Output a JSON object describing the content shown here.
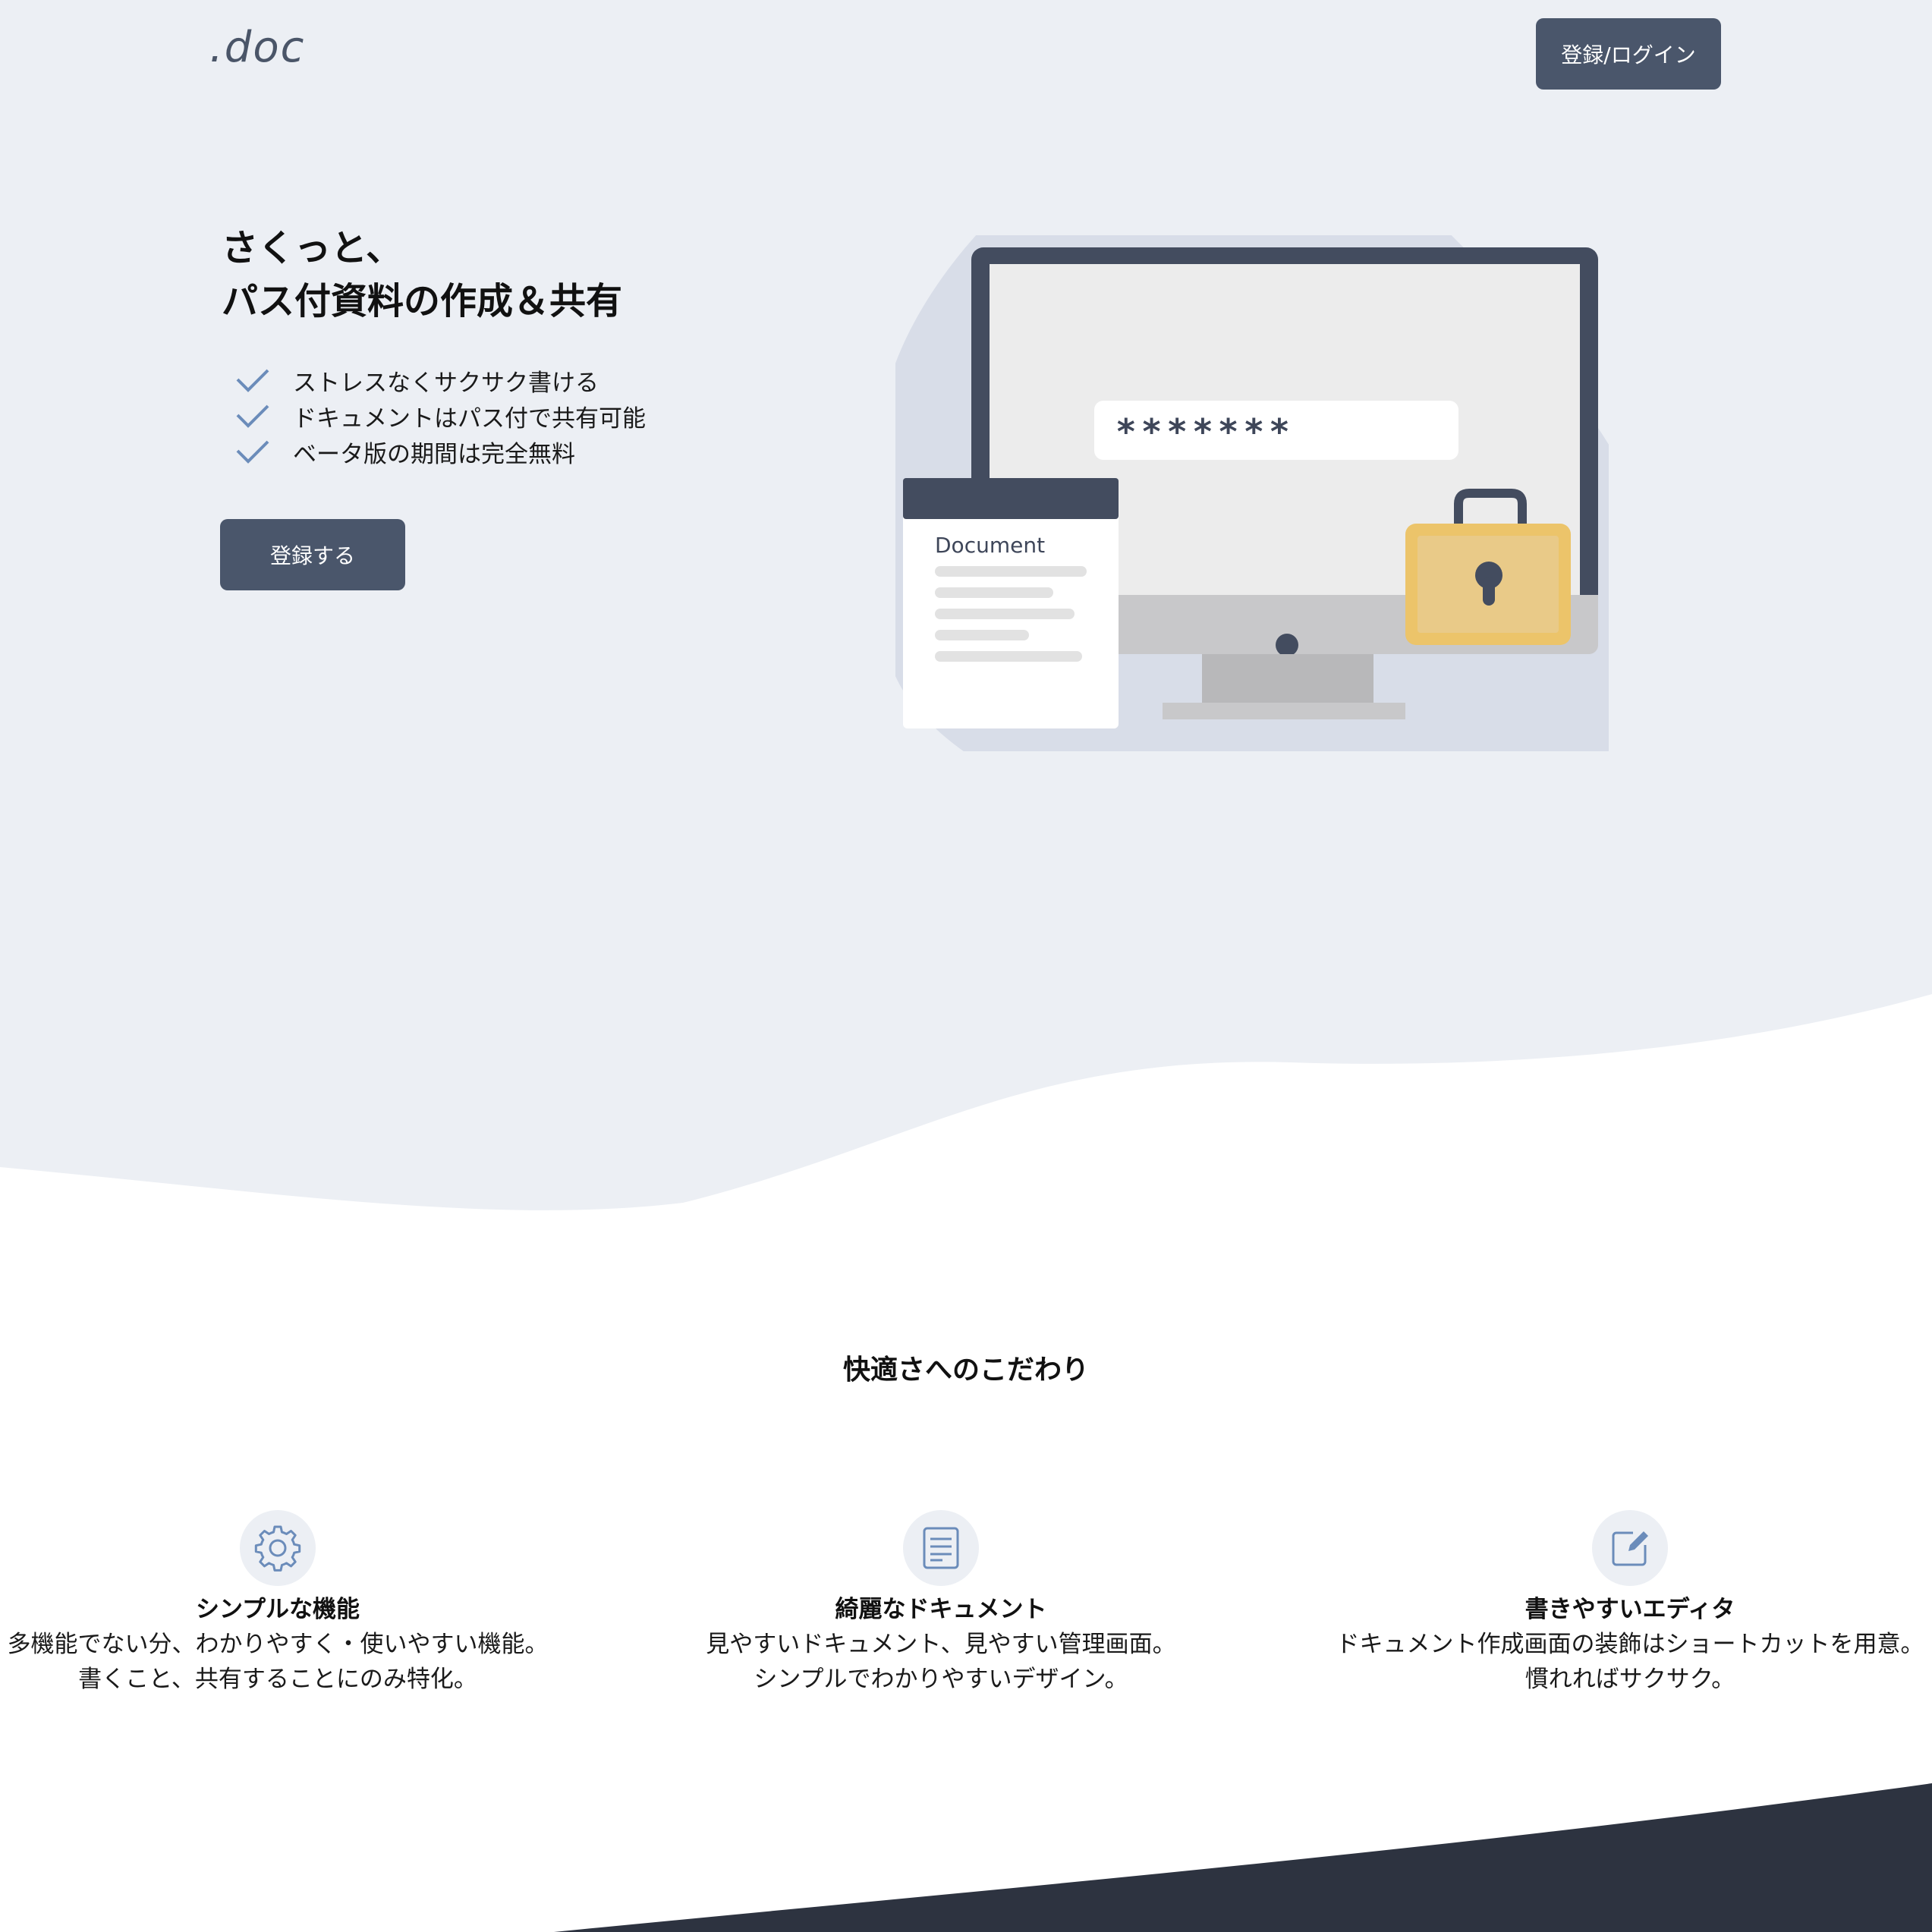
{
  "header": {
    "logo": ".doc",
    "login_label": "登録/ログイン"
  },
  "hero": {
    "title_line1": "さくっと、",
    "title_line2": "パス付資料の作成＆共有",
    "features": [
      "ストレスなくサクサク書ける",
      "ドキュメントはパス付で共有可能",
      "ベータ版の期間は完全無料"
    ],
    "register_label": "登録する"
  },
  "illustration": {
    "password_mask": "*******",
    "document_label": "Document"
  },
  "features_section": {
    "title": "快適さへのこだわり",
    "items": [
      {
        "icon": "gear-icon",
        "title": "シンプルな機能",
        "line1": "多機能でない分、わかりやすく・使いやすい機能。",
        "line2": "書くこと、共有することにのみ特化。"
      },
      {
        "icon": "document-icon",
        "title": "綺麗なドキュメント",
        "line1": "見やすいドキュメント、見やすい管理画面。",
        "line2": "シンプルでわかりやすいデザイン。"
      },
      {
        "icon": "edit-icon",
        "title": "書きやすいエディタ",
        "line1": "ドキュメント作成画面の装飾はショートカットを用意。",
        "line2": "慣れればサクサク。"
      }
    ]
  },
  "colors": {
    "hero_bg": "#eceff4",
    "blob": "#d8dde8",
    "button": "#4a566b",
    "accent_blue": "#6b8cba",
    "footer_dark": "#2d3340",
    "lock": "#ecc46a"
  }
}
